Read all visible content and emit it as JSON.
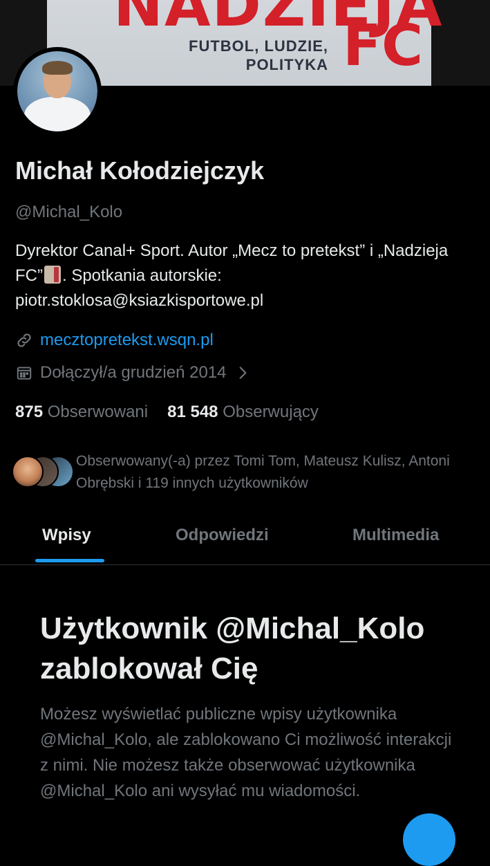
{
  "banner": {
    "title": "NADZIEJA",
    "subtitle_line1": "FUTBOL, LUDZIE,",
    "subtitle_line2": "POLITYKA",
    "fc": "FC"
  },
  "profile": {
    "name": "Michał Kołodziejczyk",
    "handle": "@Michal_Kolo",
    "bio_part1": "Dyrektor Canal+ Sport. Autor „Mecz to pretekst” i „Nadzieja FC”",
    "bio_part2": ". Spotkania autorskie: piotr.stoklosa@ksiazkisportowe.pl",
    "bio_emoji": "book-icon",
    "link": "mecztopretekst.wsqn.pl",
    "joined": "Dołączył/a grudzień 2014",
    "following_count": "875",
    "following_label": "Obserwowani",
    "followers_count": "81 548",
    "followers_label": "Obserwujący",
    "followed_by": "Obserwowany(-a) przez Tomi Tom, Mateusz Kulisz, Antoni Obrębski i 119 innych użytkowników"
  },
  "tabs": [
    {
      "label": "Wpisy"
    },
    {
      "label": "Odpowiedzi"
    },
    {
      "label": "Multimedia"
    }
  ],
  "blocked": {
    "title": "Użytkownik @Michal_Kolo zablokował Cię",
    "description": "Możesz wyświetlać publiczne wpisy użytkownika @Michal_Kolo, ale zablokowano Ci możliwość interakcji z nimi. Nie możesz także obserwować użytkownika @Michal_Kolo ani wysyłać mu wiadomości."
  },
  "colors": {
    "accent": "#1d9bf0",
    "background": "#000000",
    "secondary_text": "#71767b",
    "book_red": "#d32029"
  }
}
